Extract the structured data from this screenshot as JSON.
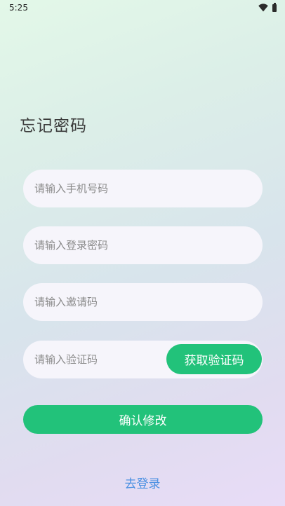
{
  "status_bar": {
    "time": "5:25",
    "icons": [
      "wifi-icon",
      "battery-icon"
    ]
  },
  "page": {
    "title": "忘记密码"
  },
  "form": {
    "phone_placeholder": "请输入手机号码",
    "password_placeholder": "请输入登录密码",
    "invite_placeholder": "请输入邀请码",
    "code_placeholder": "请输入验证码",
    "get_code_label": "获取验证码",
    "confirm_label": "确认修改",
    "login_link": "去登录"
  },
  "colors": {
    "accent": "#22c27a",
    "link": "#4a90e2",
    "field_bg": "#f6f5fb"
  }
}
